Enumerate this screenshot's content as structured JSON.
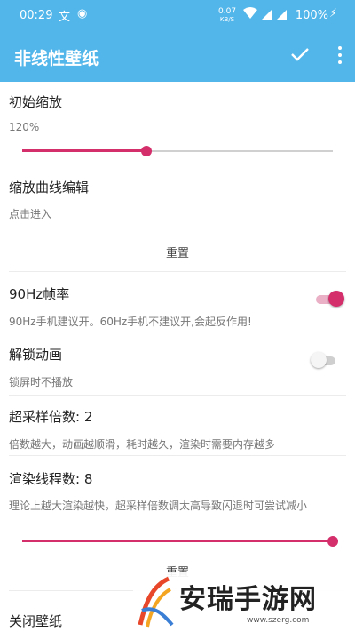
{
  "status": {
    "time": "00:29",
    "left_icons": [
      "文",
      "◉"
    ],
    "net_speed": "0.07",
    "net_unit": "KB/S",
    "battery": "100%",
    "bolt": "⚡"
  },
  "appbar": {
    "title": "非线性壁纸",
    "confirm_icon": "check-icon",
    "more_icon": "more-vert-icon"
  },
  "settings": {
    "initial_zoom": {
      "title": "初始缩放",
      "value": "120%",
      "slider_fraction": 0.4
    },
    "zoom_curve": {
      "title": "缩放曲线编辑",
      "subtitle": "点击进入",
      "reset": "重置"
    },
    "fps90": {
      "title": "90Hz帧率",
      "subtitle": "90Hz手机建议开。60Hz手机不建议开,会起反作用!",
      "enabled": true
    },
    "unlock_anim": {
      "title": "解锁动画",
      "subtitle": "锁屏时不播放",
      "enabled": false
    },
    "supersample": {
      "title": "超采样倍数: 2",
      "subtitle": "倍数越大，动画越顺滑，耗时越久，渲染时需要内存越多"
    },
    "render_threads": {
      "title": "渲染线程数: 8",
      "subtitle": "理论上越大渲染越快，超采样倍数调太高导致闪退时可尝试减小",
      "slider_fraction": 1.0,
      "reset": "重置"
    },
    "close_wallpaper": {
      "title": "关闭壁纸"
    }
  },
  "watermark": {
    "text": "安瑞手游网",
    "url": "www.szerg.com"
  },
  "colors": {
    "primary": "#52b6ea",
    "accent": "#d42e6b"
  }
}
